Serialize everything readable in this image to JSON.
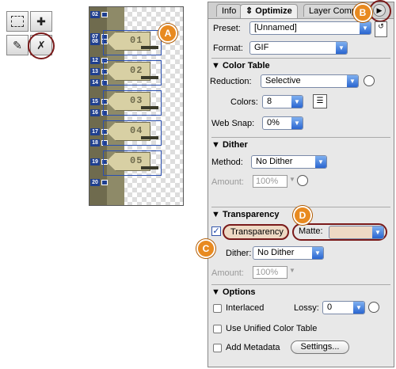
{
  "callouts": {
    "a": "A",
    "b": "B",
    "c": "C",
    "d": "D"
  },
  "slices": [
    {
      "num": "02"
    },
    {
      "num": "07"
    },
    {
      "num": "08"
    },
    {
      "num": "12"
    },
    {
      "num": "13"
    },
    {
      "num": "14"
    },
    {
      "num": "15"
    },
    {
      "num": "16"
    },
    {
      "num": "17"
    },
    {
      "num": "18"
    },
    {
      "num": "19"
    },
    {
      "num": "20"
    }
  ],
  "slice_buttons": [
    "01",
    "02",
    "03",
    "04",
    "05"
  ],
  "tabs": {
    "info": "Info",
    "optimize": "Optimize",
    "layer_comps": "Layer Comps"
  },
  "preset": {
    "label": "Preset:",
    "value": "[Unnamed]"
  },
  "format": {
    "label": "Format:",
    "value": "GIF"
  },
  "color_table": {
    "title": "Color Table",
    "reduction_label": "Reduction:",
    "reduction_value": "Selective",
    "colors_label": "Colors:",
    "colors_value": "8",
    "websnap_label": "Web Snap:",
    "websnap_value": "0%"
  },
  "dither": {
    "title": "Dither",
    "method_label": "Method:",
    "method_value": "No Dither",
    "amount_label": "Amount:",
    "amount_value": "100%"
  },
  "transparency": {
    "title": "Transparency",
    "checkbox_label": "Transparency",
    "matte_label": "Matte:",
    "dither_label": "Dither:",
    "dither_value": "No Dither",
    "amount_label": "Amount:",
    "amount_value": "100%"
  },
  "options": {
    "title": "Options",
    "interlaced_label": "Interlaced",
    "lossy_label": "Lossy:",
    "lossy_value": "0",
    "unified_label": "Use Unified Color Table",
    "metadata_label": "Add Metadata",
    "settings_label": "Settings..."
  },
  "icons": [
    "marquee-icon",
    "move-icon",
    "slice-icon",
    "slice-select-icon",
    "menu-arrow-icon",
    "color-table-icon",
    "link-icon"
  ]
}
